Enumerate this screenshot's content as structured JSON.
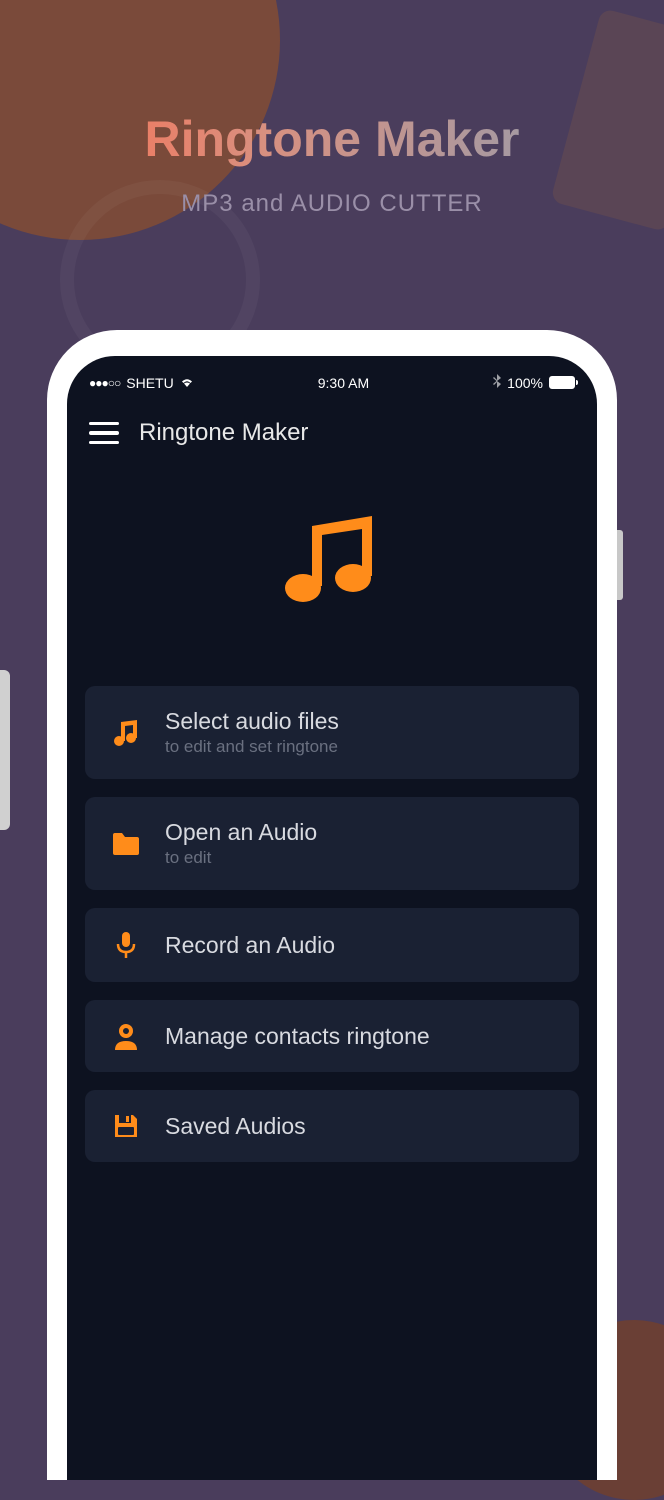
{
  "promo": {
    "title": "Ringtone Maker",
    "subtitle": "MP3 and AUDIO CUTTER"
  },
  "statusBar": {
    "carrier": "SHETU",
    "time": "9:30 AM",
    "battery": "100%"
  },
  "app": {
    "title": "Ringtone Maker"
  },
  "menu": {
    "selectAudio": {
      "title": "Select audio files",
      "sub": "to edit and set ringtone"
    },
    "openAudio": {
      "title": "Open an Audio",
      "sub": "to edit"
    },
    "record": {
      "title": "Record an Audio"
    },
    "contacts": {
      "title": "Manage contacts ringtone"
    },
    "saved": {
      "title": "Saved Audios"
    }
  }
}
